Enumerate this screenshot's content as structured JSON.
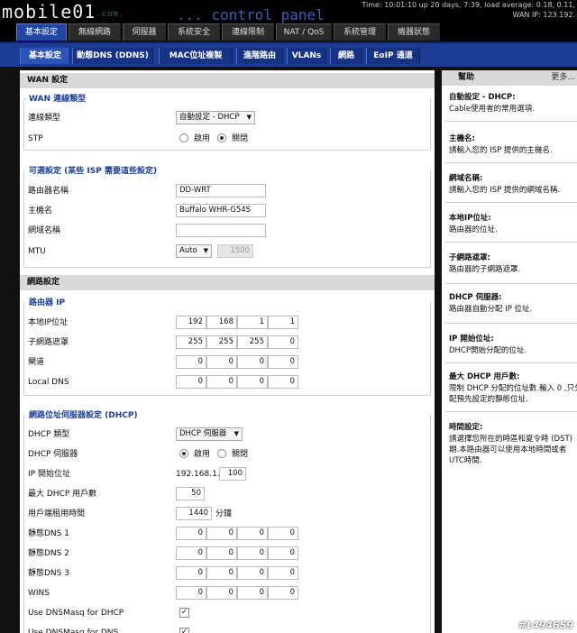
{
  "header": {
    "logo_text": "mobile01",
    "logo_suffix": ".com",
    "panel_title": "... control panel",
    "time_line": "Time: 10:01:10 up 20 days, 7:39, load average: 0.18, 0.11,",
    "wan_ip_line": "WAN IP: 123.192."
  },
  "tabs_primary": [
    "基本設定",
    "無線網路",
    "伺服器",
    "系統安全",
    "連線限制",
    "NAT / QoS",
    "系統管理",
    "機器狀態"
  ],
  "tabs_secondary": [
    "基本設定",
    "動態DNS (DDNS)",
    "MAC位址複製",
    "進階路由",
    "VLANs",
    "網路",
    "EoIP 通道"
  ],
  "wan": {
    "header": "WAN 設定",
    "type_legend": "WAN 連線類型",
    "conn_type_label": "連線類型",
    "conn_type_value": "自動設定 - DHCP",
    "stp_label": "STP",
    "stp_on": "啟用",
    "stp_off": "關閉",
    "opt_legend": "可選設定 (某些 ISP 需要這些設定)",
    "router_name_label": "路由器名稱",
    "router_name_value": "DD-WRT",
    "hostname_label": "主機名",
    "hostname_value": "Buffalo WHR-G54S",
    "domain_label": "網域名稱",
    "domain_value": "",
    "mtu_label": "MTU",
    "mtu_mode": "Auto",
    "mtu_value": "1500"
  },
  "network": {
    "header": "網路設定",
    "ip_legend": "路由器 IP",
    "local_ip_label": "本地IP位址",
    "local_ip": [
      "192",
      "168",
      "1",
      "1"
    ],
    "mask_label": "子網路遮罩",
    "mask": [
      "255",
      "255",
      "255",
      "0"
    ],
    "gateway_label": "閘道",
    "gateway": [
      "0",
      "0",
      "0",
      "0"
    ],
    "local_dns_label": "Local DNS",
    "local_dns": [
      "0",
      "0",
      "0",
      "0"
    ],
    "dhcp_legend": "網路位址伺服器設定 (DHCP)",
    "dhcp_type_label": "DHCP 類型",
    "dhcp_type_value": "DHCP 伺服器",
    "dhcp_server_label": "DHCP 伺服器",
    "dhcp_on": "啟用",
    "dhcp_off": "關閉",
    "start_ip_label": "IP 開始位址",
    "start_ip_prefix": "192.168.1.",
    "start_ip_value": "100",
    "max_users_label": "最大 DHCP 用戶數",
    "max_users_value": "50",
    "lease_label": "用戶端租用時間",
    "lease_value": "1440",
    "lease_unit": "分鐘",
    "dns1_label": "靜態DNS 1",
    "dns2_label": "靜態DNS 2",
    "dns3_label": "靜態DNS 3",
    "wins_label": "WINS",
    "zero_ip": [
      "0",
      "0",
      "0",
      "0"
    ],
    "dnsmasq_dhcp_label": "Use DNSMasq for DHCP",
    "dnsmasq_dns_label": "Use DNSMasq for DNS",
    "check_mark": "✓"
  },
  "help": {
    "title": "幫助",
    "more": "更多...",
    "items": [
      {
        "title": "自動設定 - DHCP:",
        "lines": [
          "Cable使用者的常用選項."
        ]
      },
      {
        "title": "主機名:",
        "lines": [
          "請輸入您的 ISP 提供的主機名."
        ]
      },
      {
        "title": "網域名稱:",
        "lines": [
          "請輸入您的 ISP 提供的網域名稱."
        ]
      },
      {
        "title": "本地IP位址:",
        "lines": [
          "路由器的位址."
        ]
      },
      {
        "title": "子網路遮罩:",
        "lines": [
          "路由器的子網路遮罩."
        ]
      },
      {
        "title": "DHCP 伺服器:",
        "lines": [
          "路由器自動分配 IP 位址."
        ]
      },
      {
        "title": "IP 開始位址:",
        "lines": [
          "DHCP開始分配的位址."
        ]
      },
      {
        "title": "最大 DHCP 用戶數:",
        "lines": [
          "限制 DHCP 分配的位址數.輸入 0 ,只分",
          "配預先設定的靜態位址."
        ]
      },
      {
        "title": "時間設定:",
        "lines": [
          "請選擇您所在的時區和夏令時 (DST)",
          "期.本路由器可以使用本地時間或者",
          "UTC時間."
        ]
      }
    ]
  },
  "watermark": "#1494659"
}
